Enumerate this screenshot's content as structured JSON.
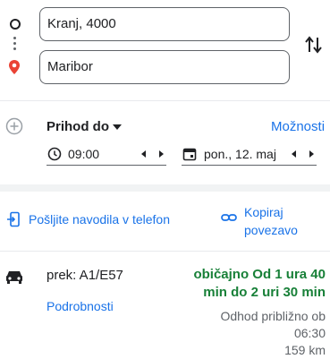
{
  "route": {
    "origin_value": "Kranj, 4000",
    "destination_value": "Maribor"
  },
  "options": {
    "arrive_by_label": "Prihod do",
    "options_link": "Možnosti",
    "time_value": "09:00",
    "date_value": "pon., 12. maj"
  },
  "actions": {
    "send_to_phone": "Pošljite navodila v telefon",
    "copy_link_line1": "Kopiraj",
    "copy_link_line2": "povezavo"
  },
  "result": {
    "via": "prek: A1/E57",
    "details_link": "Podrobnosti",
    "duration_line1": "običajno Od 1 ura 40",
    "duration_line2": "min do 2 uri 30 min",
    "departure_line1": "Odhod približno ob",
    "departure_line2": "06:30",
    "distance": "159 km"
  },
  "colors": {
    "link": "#1a73e8",
    "duration": "#188038",
    "pin": "#ea4335"
  }
}
